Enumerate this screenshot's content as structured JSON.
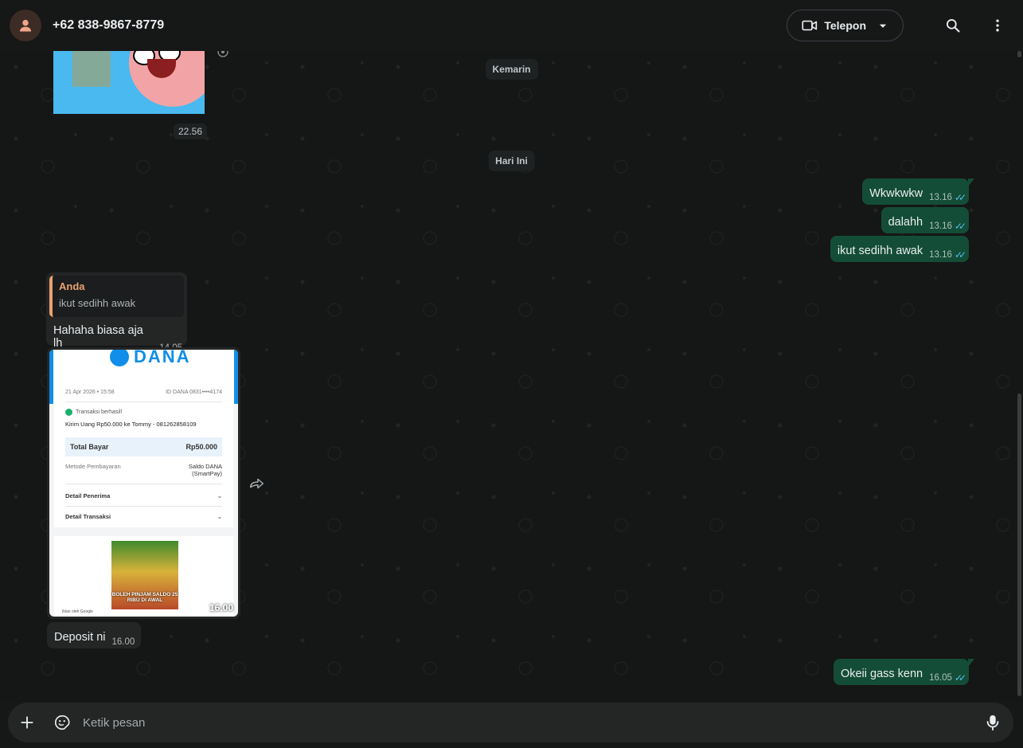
{
  "header": {
    "contact_name": "+62 838-9867-8779",
    "call_label": "Telepon"
  },
  "chat": {
    "top_image_time": "22.56",
    "date_yesterday": "Kemarin",
    "date_today": "Hari Ini",
    "messages_out": [
      {
        "text": "Wkwkwkw",
        "time": "13.16"
      },
      {
        "text": "dalahh",
        "time": "13.16"
      },
      {
        "text": "ikut sedihh awak",
        "time": "13.16"
      }
    ],
    "reply": {
      "quoted_author": "Anda",
      "quoted_text": "ikut sedihh awak",
      "text": "Hahaha biasa aja lh",
      "time": "14.05"
    },
    "receipt": {
      "brand": "DANA",
      "date": "21 Apr 2026 • 15:58",
      "account_id": "ID DANA 0831••••4174",
      "status": "Transaksi berhasil!",
      "description": "Kirim Uang Rp50.000 ke Tommy - 081262858109",
      "total_label": "Total Bayar",
      "total_value": "Rp50.000",
      "method_label": "Metode Pembayaran",
      "method_value_1": "Saldo DANA",
      "method_value_2": "(SmartPay)",
      "detail_recipient": "Detail Penerima",
      "detail_transaction": "Detail Transaksi",
      "ad_text": "BOLEH PINJAM SALDO 25 RIBU DI AWAL",
      "ad_label": "Iklan oleh Google",
      "time": "16.00"
    },
    "deposit": {
      "text": "Deposit ni",
      "time": "16.00"
    },
    "last_out": {
      "text": "Okeii gass kenn",
      "time": "16.05"
    }
  },
  "composer": {
    "placeholder": "Ketik pesan"
  }
}
